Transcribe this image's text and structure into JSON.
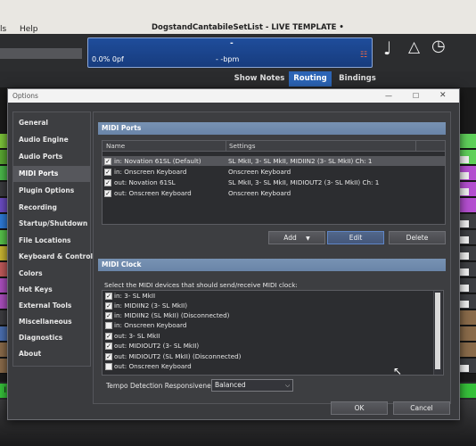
{
  "app": {
    "menu_left": "ls",
    "menu_help": "Help",
    "title": "DogstandCantabileSetList - LIVE TEMPLATE •",
    "lcd": {
      "top_mark": "-",
      "left_readout": "0.0%  0pf",
      "tempo_readout": "- -bpm"
    },
    "tabs": [
      {
        "label": "Show Notes",
        "active": false
      },
      {
        "label": "Routing",
        "active": true
      },
      {
        "label": "Bindings",
        "active": false
      }
    ],
    "bottom_left_label": "II"
  },
  "dialog": {
    "title": "Options",
    "sidebar": [
      {
        "label": "General",
        "selected": false
      },
      {
        "label": "Audio Engine",
        "selected": false
      },
      {
        "label": "Audio Ports",
        "selected": false
      },
      {
        "label": "MIDI Ports",
        "selected": true
      },
      {
        "label": "Plugin Options",
        "selected": false
      },
      {
        "label": "Recording",
        "selected": false
      },
      {
        "label": "Startup/Shutdown",
        "selected": false
      },
      {
        "label": "File Locations",
        "selected": false
      },
      {
        "label": "Keyboard & Controls",
        "selected": false
      },
      {
        "label": "Colors",
        "selected": false
      },
      {
        "label": "Hot Keys",
        "selected": false
      },
      {
        "label": "External Tools",
        "selected": false
      },
      {
        "label": "Miscellaneous",
        "selected": false
      },
      {
        "label": "Diagnostics",
        "selected": false
      },
      {
        "label": "About",
        "selected": false
      }
    ],
    "midi_ports": {
      "header": "MIDI Ports",
      "columns": {
        "name": "Name",
        "settings": "Settings"
      },
      "rows": [
        {
          "checked": true,
          "name": "in: Novation 61SL (Default)",
          "settings": "SL MkII, 3- SL MkII, MIDIIN2 (3- SL MkII) Ch: 1",
          "selected": true
        },
        {
          "checked": true,
          "name": "in: Onscreen Keyboard",
          "settings": "Onscreen Keyboard",
          "selected": false
        },
        {
          "checked": true,
          "name": "out: Novation 61SL",
          "settings": "SL MkII, 3- SL MkII, MIDIOUT2 (3- SL MkII) Ch: 1",
          "selected": false
        },
        {
          "checked": true,
          "name": "out: Onscreen Keyboard",
          "settings": "Onscreen Keyboard",
          "selected": false
        }
      ],
      "buttons": {
        "add": "Add",
        "edit": "Edit",
        "delete": "Delete"
      }
    },
    "midi_clock": {
      "header": "MIDI Clock",
      "instruction": "Select the MIDI devices that should send/receive MIDI clock:",
      "devices": [
        {
          "checked": true,
          "label": "in: 3- SL MkII"
        },
        {
          "checked": true,
          "label": "in: MIDIIN2 (3- SL MkII)"
        },
        {
          "checked": true,
          "label": "in: MIDIIN2 (SL MkII) (Disconnected)"
        },
        {
          "checked": false,
          "label": "in: Onscreen Keyboard"
        },
        {
          "checked": true,
          "label": "out: 3- SL MkII"
        },
        {
          "checked": true,
          "label": "out: MIDIOUT2 (3- SL MkII)"
        },
        {
          "checked": true,
          "label": "out: MIDIOUT2 (SL MkII) (Disconnected)"
        },
        {
          "checked": false,
          "label": "out: Onscreen Keyboard"
        }
      ],
      "tempo_label": "Tempo Detection Responsiveness:",
      "tempo_value": "Balanced"
    },
    "footer": {
      "ok": "OK",
      "cancel": "Cancel"
    }
  },
  "colors": {
    "accent": "#2c64b5",
    "section_header": "#7090b2",
    "dialog_bg": "#3a3b3e"
  }
}
